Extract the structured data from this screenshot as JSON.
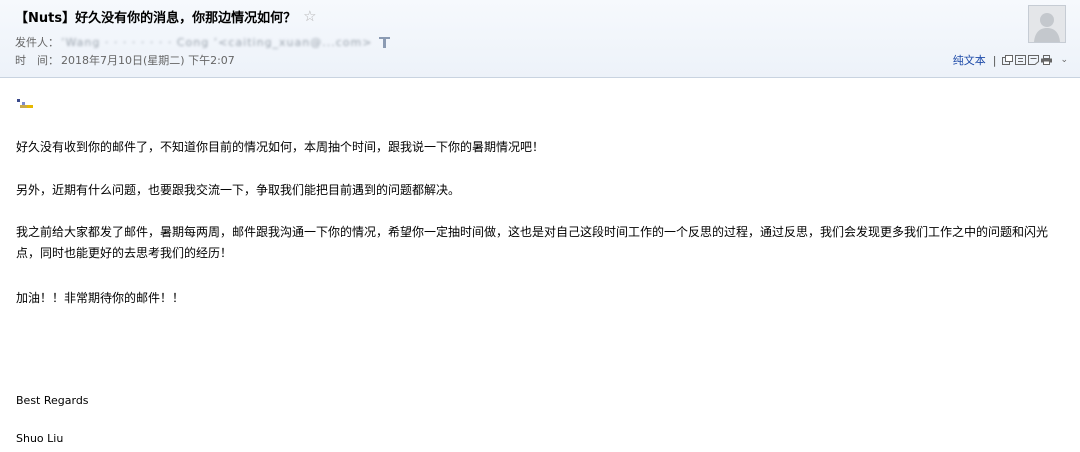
{
  "email": {
    "subject": "【Nuts】好久没有你的消息，你那边情况如何？",
    "star_icon": "star-outline-icon",
    "sender_label": "发件人：",
    "sender_value": "ʼWang · · · · · · · · Cong ʼ<caiting_xuan@...com>",
    "time_label": "时　间：",
    "time_value": "2018年7月10日(星期二) 下午2:07",
    "avatar_icon": "user-avatar-placeholder-icon",
    "toolbar": {
      "plain_text": "纯文本",
      "separator": "|",
      "icons": [
        "new-window-icon",
        "copy-icon",
        "note-icon",
        "print-icon"
      ],
      "more_icon": "chevron-down-icon"
    }
  },
  "body": {
    "emoji_icon": "emoji-smiley-icon",
    "paragraphs": [
      "好久没有收到你的邮件了，不知道你目前的情况如何，本周抽个时间，跟我说一下你的暑期情况吧！",
      "另外，近期有什么问题，也要跟我交流一下，争取我们能把目前遇到的问题都解决。",
      "我之前给大家都发了邮件，暑期每两周，邮件跟我沟通一下你的情况，希望你一定抽时间做，这也是对自己这段时间工作的一个反思的过程，通过反思，我们会发现更多我们工作之中的问题和闪光点，同时也能更好的去思考我们的经历！",
      "加油！！非常期待你的邮件！！"
    ],
    "closing": "Best Regards",
    "signature_name": "Shuo Liu"
  },
  "colors": {
    "header_bg": "#eef3fa",
    "link": "#1d4aa8",
    "muted_text": "#666666"
  }
}
